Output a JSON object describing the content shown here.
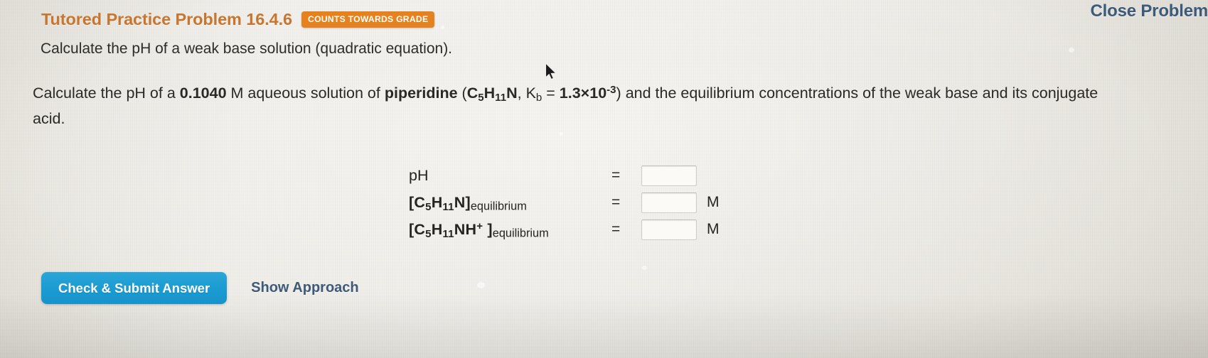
{
  "header": {
    "problem_title": "Tutored Practice Problem 16.4.6",
    "grade_badge": "COUNTS TOWARDS GRADE",
    "close_label": "Close Problem"
  },
  "subtitle": "Calculate the pH of a weak base solution (quadratic equation).",
  "problem": {
    "part1": "Calculate the pH of a ",
    "concentration": "0.1040",
    "part2": " M aqueous solution of ",
    "compound": "piperidine",
    "formula_open": " (",
    "formula_C": "C",
    "formula_C_sub": "5",
    "formula_H": "H",
    "formula_H_sub": "11",
    "formula_N": "N",
    "comma": ", ",
    "kb_symbol": "K",
    "kb_sub": "b",
    "kb_equals": " = ",
    "kb_value": "1.3×10",
    "kb_exponent": "-3",
    "formula_close": ") ",
    "part3": "and the equilibrium concentrations of the weak base and its conjugate acid."
  },
  "answers": {
    "rows": [
      {
        "label_plain": "pH",
        "equals": "=",
        "value": "",
        "unit": ""
      },
      {
        "bracket_open": "[",
        "f_C": "C",
        "f_C_sub": "5",
        "f_H": "H",
        "f_H_sub": "11",
        "f_N": "N",
        "bracket_close": "]",
        "subscript_word": "equilibrium",
        "equals": "=",
        "value": "",
        "unit": "M"
      },
      {
        "bracket_open": "[",
        "f_C": "C",
        "f_C_sub": "5",
        "f_H": "H",
        "f_H_sub": "11",
        "f_N": "NH",
        "f_charge": "+",
        "bracket_close": " ]",
        "subscript_word": "equilibrium",
        "equals": "=",
        "value": "",
        "unit": "M"
      }
    ]
  },
  "footer": {
    "check_submit_label": "Check & Submit Answer",
    "show_approach_label": "Show Approach"
  },
  "colors": {
    "title_orange": "#c8762f",
    "badge_orange": "#e6821d",
    "link_slate": "#3d5a78",
    "button_blue": "#1b9bd1",
    "body_text": "#2b2926",
    "page_background": "#e9e7e1"
  }
}
